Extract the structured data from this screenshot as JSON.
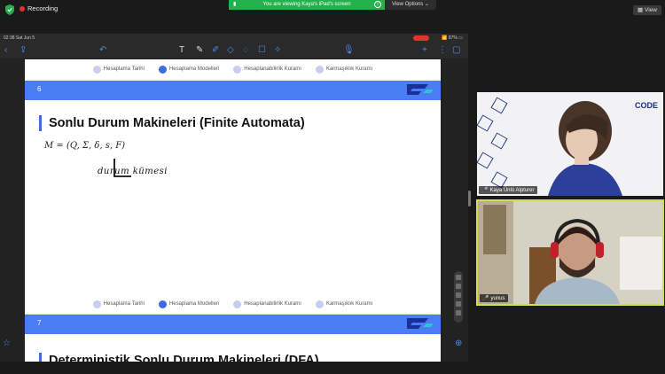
{
  "zoom": {
    "recording_label": "Recording",
    "share_banner": "You are viewing Kaya's iPad's screen",
    "view_options": "View Options",
    "view_button": "View",
    "shield_color": "#22b14c"
  },
  "ipad": {
    "time": "02:38",
    "date": "Sat Jun 5",
    "battery": "87%",
    "toolbar_icons": [
      "back-icon",
      "share-icon",
      "undo-icon",
      "text-tool-icon",
      "pen-icon",
      "highlighter-icon",
      "eraser-icon",
      "lasso-icon",
      "shapes-icon",
      "sticker-icon",
      "mic-icon",
      "add-page-icon",
      "more-icon",
      "pages-icon"
    ]
  },
  "document": {
    "nav_items": [
      "Hesaplama Tarihi",
      "Hesaplama Modelleri",
      "Hesaplanabilirlik Kuramı",
      "Karmaşıklık Kuramı"
    ],
    "slide6": {
      "number": "6",
      "title": "Sonlu Durum Makineleri (Finite Automata)",
      "formula": "M = (Q, Σ, δ, s, F)",
      "handwriting": "durum kümesi"
    },
    "slide7": {
      "number": "7",
      "title": "Deterministik Sonlu Durum Makineleri (DFA)"
    }
  },
  "participants": [
    {
      "name": "Kaya Ünlü Alpturer"
    },
    {
      "name": "yunus"
    }
  ],
  "tile1_brand": "CODE"
}
